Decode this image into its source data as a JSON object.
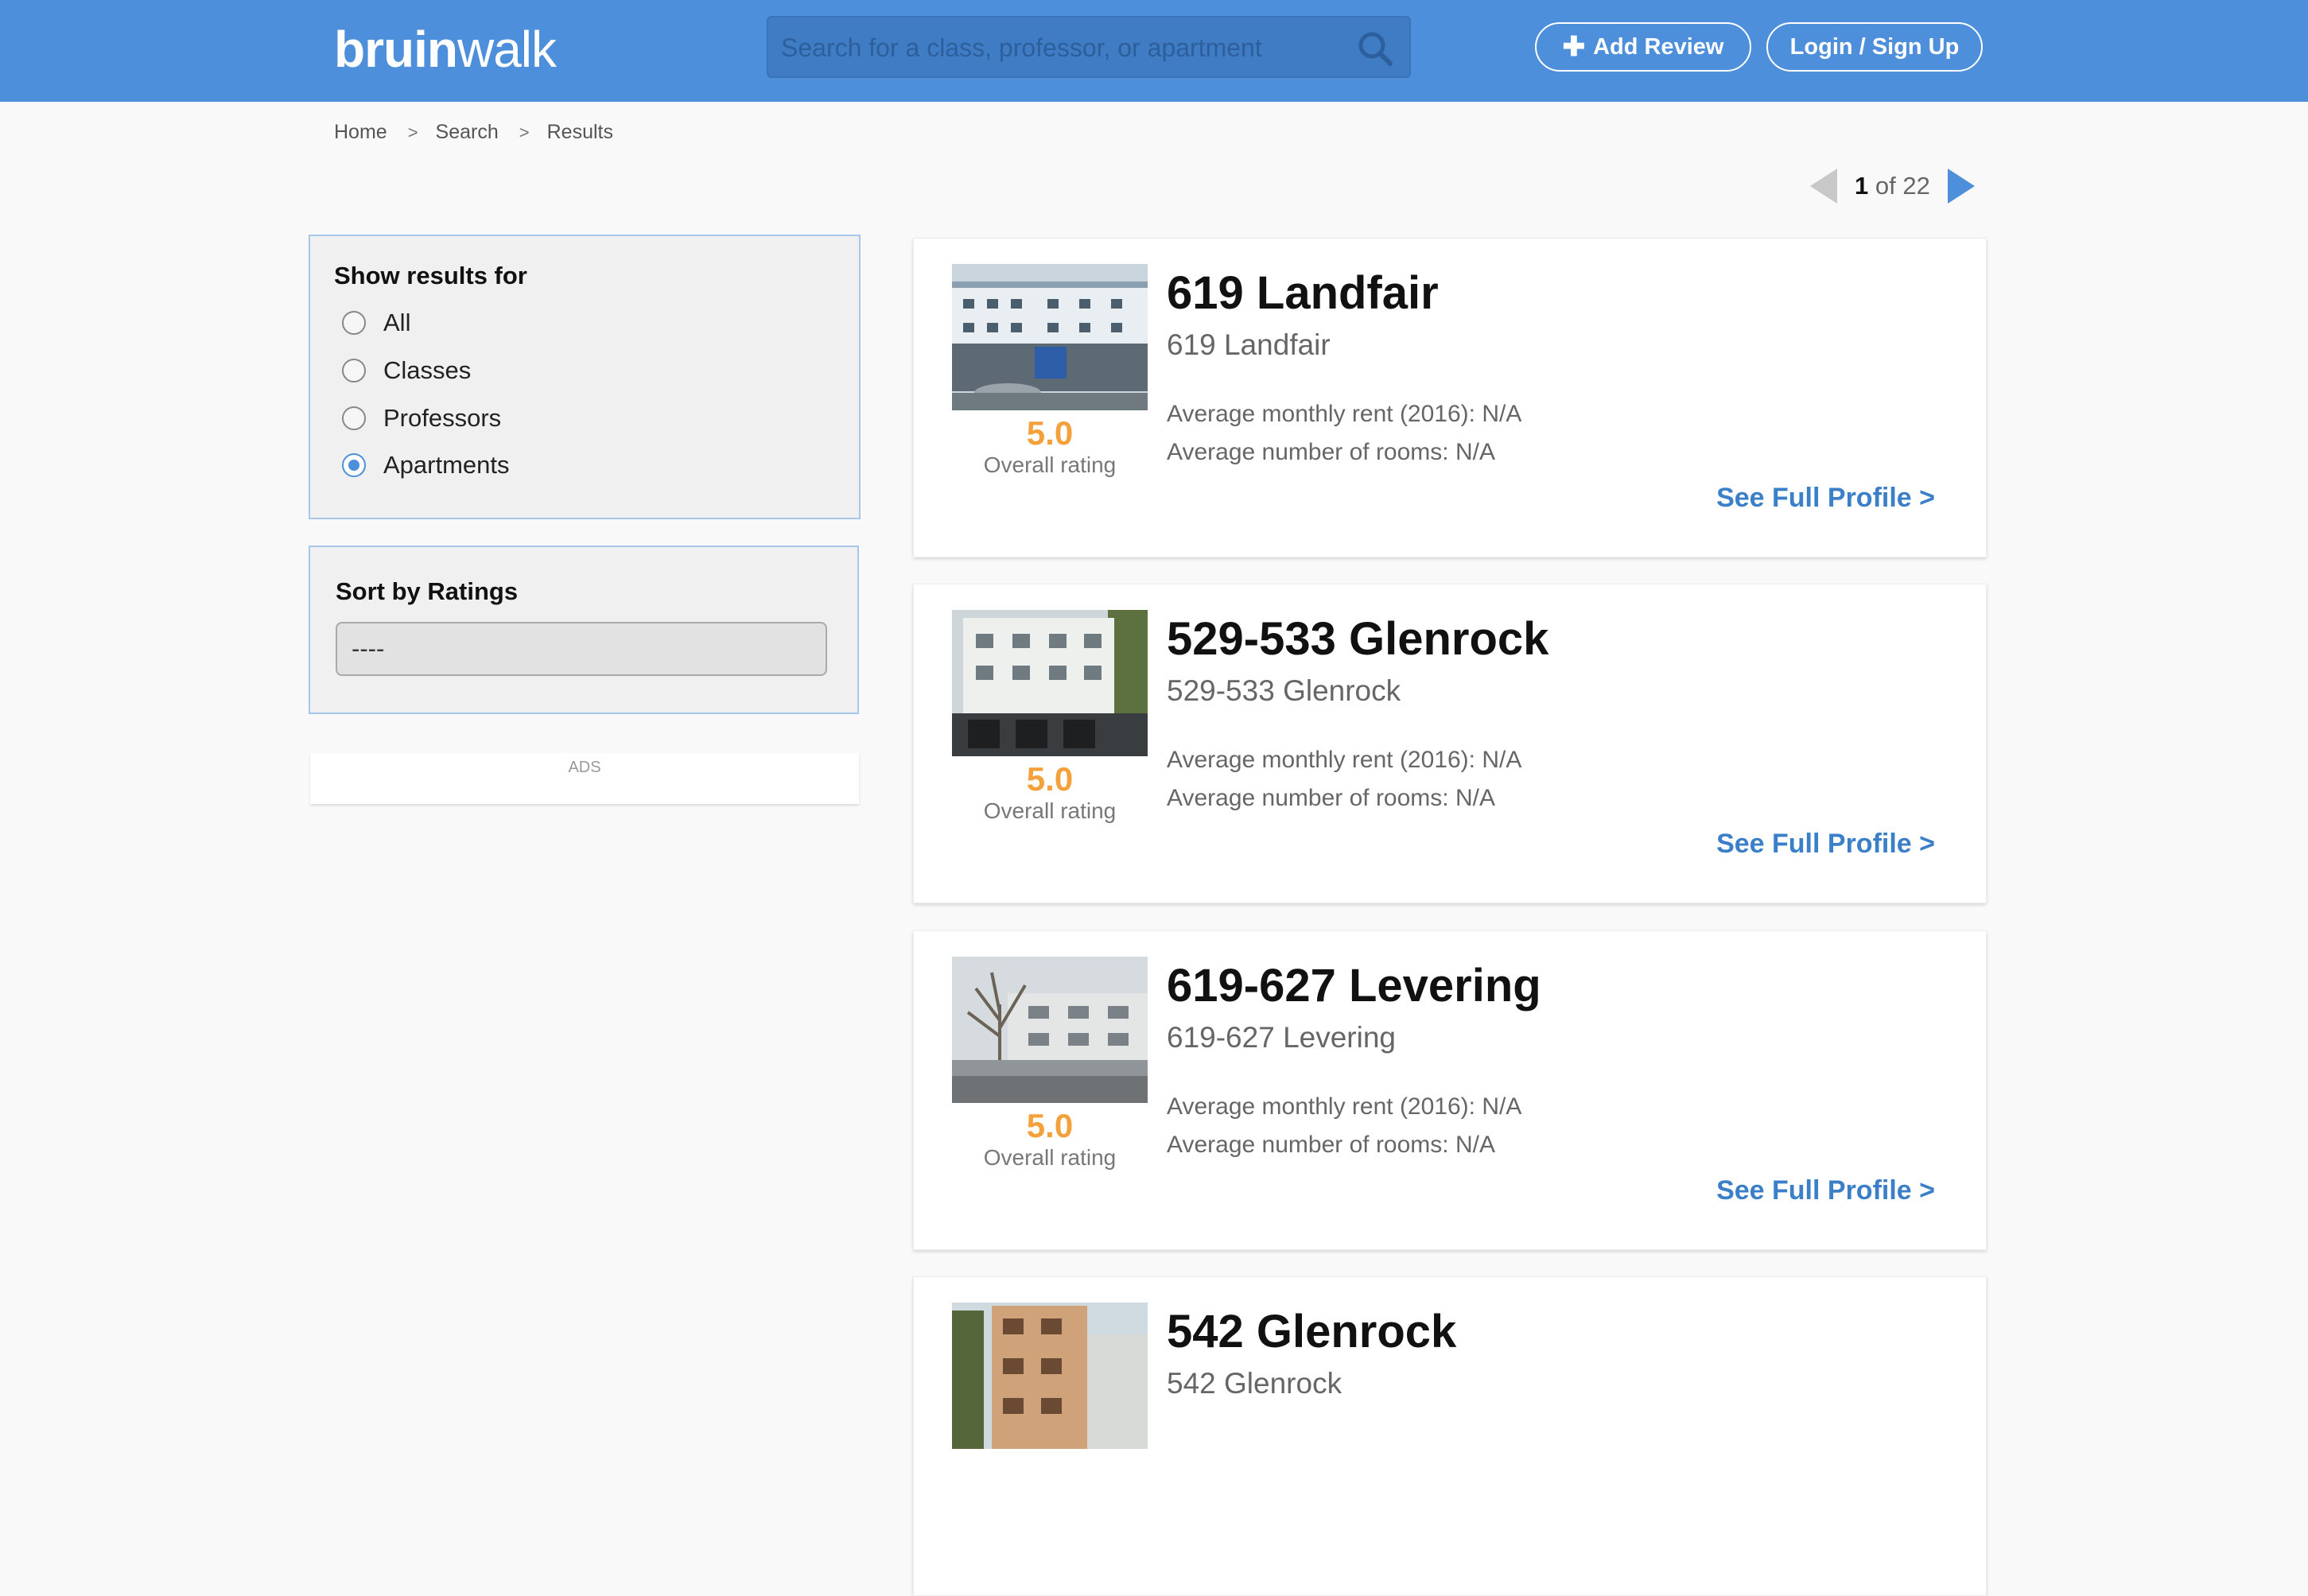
{
  "header": {
    "logo_bold": "bruin",
    "logo_regular": "walk",
    "search_placeholder": "Search for a class, professor, or apartment",
    "add_review_label": "Add Review",
    "login_label": "Login / Sign Up"
  },
  "breadcrumb": {
    "items": [
      "Home",
      "Search",
      "Results"
    ],
    "separator": ">"
  },
  "pagination": {
    "current": "1",
    "of_text": "of 22"
  },
  "filter": {
    "title": "Show results for",
    "options": [
      "All",
      "Classes",
      "Professors",
      "Apartments"
    ],
    "selected": "Apartments"
  },
  "sort": {
    "title": "Sort by Ratings",
    "value": "----"
  },
  "ads_label": "ADS",
  "results": [
    {
      "title": "619 Landfair",
      "subtitle": "619 Landfair",
      "rating": "5.0",
      "rating_label": "Overall rating",
      "rent": "Average monthly rent (2016): N/A",
      "rooms": "Average number of rooms: N/A",
      "link": "See Full Profile >"
    },
    {
      "title": "529-533 Glenrock",
      "subtitle": "529-533 Glenrock",
      "rating": "5.0",
      "rating_label": "Overall rating",
      "rent": "Average monthly rent (2016): N/A",
      "rooms": "Average number of rooms: N/A",
      "link": "See Full Profile >"
    },
    {
      "title": "619-627 Levering",
      "subtitle": "619-627 Levering",
      "rating": "5.0",
      "rating_label": "Overall rating",
      "rent": "Average monthly rent (2016): N/A",
      "rooms": "Average number of rooms: N/A",
      "link": "See Full Profile >"
    },
    {
      "title": "542 Glenrock",
      "subtitle": "542 Glenrock"
    }
  ],
  "colors": {
    "header_bg": "#4d8fdb",
    "rating": "#f4a13c",
    "link": "#3b7fc8"
  }
}
